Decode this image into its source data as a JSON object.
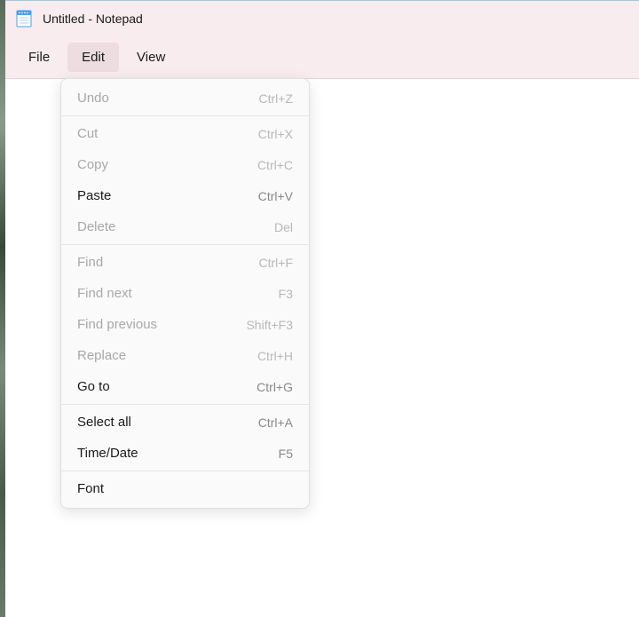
{
  "window": {
    "title": "Untitled - Notepad"
  },
  "menubar": {
    "items": [
      {
        "label": "File",
        "active": false
      },
      {
        "label": "Edit",
        "active": true
      },
      {
        "label": "View",
        "active": false
      }
    ]
  },
  "edit_menu": {
    "groups": [
      [
        {
          "label": "Undo",
          "shortcut": "Ctrl+Z",
          "enabled": false
        }
      ],
      [
        {
          "label": "Cut",
          "shortcut": "Ctrl+X",
          "enabled": false
        },
        {
          "label": "Copy",
          "shortcut": "Ctrl+C",
          "enabled": false
        },
        {
          "label": "Paste",
          "shortcut": "Ctrl+V",
          "enabled": true
        },
        {
          "label": "Delete",
          "shortcut": "Del",
          "enabled": false
        }
      ],
      [
        {
          "label": "Find",
          "shortcut": "Ctrl+F",
          "enabled": false
        },
        {
          "label": "Find next",
          "shortcut": "F3",
          "enabled": false
        },
        {
          "label": "Find previous",
          "shortcut": "Shift+F3",
          "enabled": false
        },
        {
          "label": "Replace",
          "shortcut": "Ctrl+H",
          "enabled": false
        },
        {
          "label": "Go to",
          "shortcut": "Ctrl+G",
          "enabled": true
        }
      ],
      [
        {
          "label": "Select all",
          "shortcut": "Ctrl+A",
          "enabled": true
        },
        {
          "label": "Time/Date",
          "shortcut": "F5",
          "enabled": true
        }
      ],
      [
        {
          "label": "Font",
          "shortcut": "",
          "enabled": true
        }
      ]
    ]
  }
}
